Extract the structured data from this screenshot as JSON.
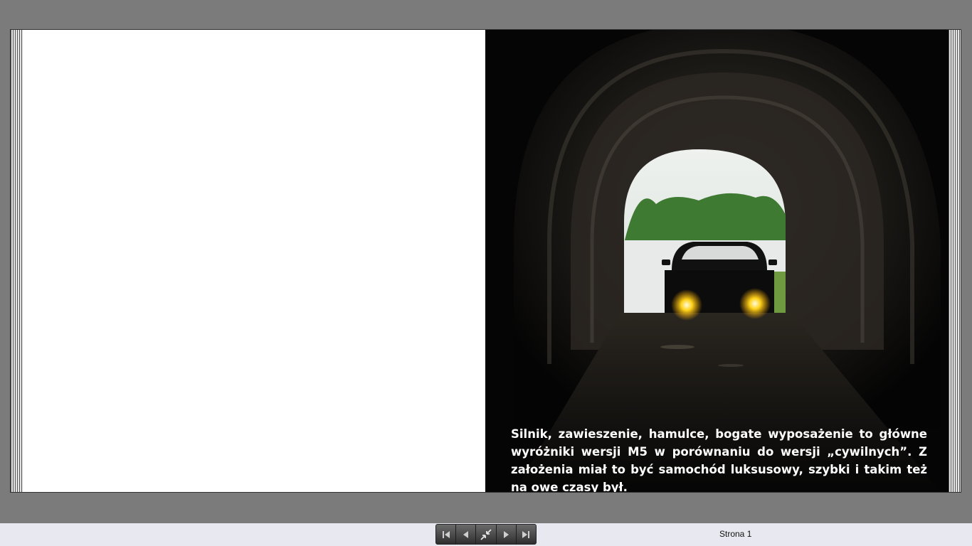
{
  "viewer": {
    "caption": "Silnik, zawieszenie, hamulce, bogate wyposażenie to główne wyróżniki wersji M5 w porównaniu do wersji „cywilnych”. Z założenia miał to być samochód luksusowy, szybki i takim też na owe czasy był.",
    "page_label": "Strona 1"
  },
  "controls": {
    "buttons": [
      {
        "icon": "first-page-icon"
      },
      {
        "icon": "prev-page-icon"
      },
      {
        "icon": "collapse-icon"
      },
      {
        "icon": "next-page-icon"
      },
      {
        "icon": "last-page-icon"
      }
    ]
  },
  "colors": {
    "background": "#7b7b7b",
    "bottom_bar": "#e8e8f1",
    "headlight": "#ffd21a"
  }
}
